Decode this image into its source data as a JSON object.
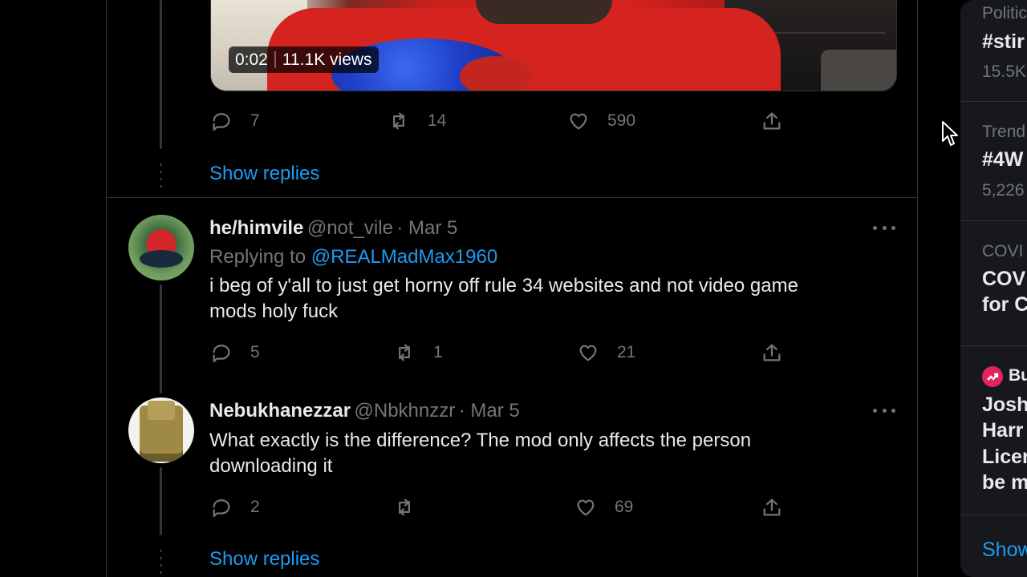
{
  "video": {
    "time": "0:02",
    "views": "11.1K views"
  },
  "tweets": [
    {
      "actions": {
        "replies": "7",
        "retweets": "14",
        "likes": "590"
      },
      "show_replies": "Show replies"
    },
    {
      "display_name": "he/himvile",
      "handle": "@not_vile",
      "date": "· Mar 5",
      "replying_to_label": "Replying to",
      "replying_to_handle": "@REALMadMax1960",
      "text_line1": "i beg of y'all to just get horny off rule 34 websites and not video game",
      "text_line2": "mods holy fuck",
      "actions": {
        "replies": "5",
        "retweets": "1",
        "likes": "21"
      }
    },
    {
      "display_name": "Nebukhanezzar",
      "handle": "@Nbkhnzzr",
      "date": "· Mar 5",
      "text_line1": "What exactly is the difference? The mod only affects the person",
      "text_line2": "downloading it",
      "actions": {
        "replies": "2",
        "retweets": "",
        "likes": "69"
      },
      "show_replies": "Show replies"
    }
  ],
  "sidebar": {
    "items": [
      {
        "category": "Politic",
        "title": "#stir",
        "count": "15.5K"
      },
      {
        "category": "Trend",
        "title": "#4W",
        "count": "5,226"
      },
      {
        "category": "COVI",
        "title_line1": "COV",
        "title_line2": "for C"
      },
      {
        "category": "Bu",
        "title_line1": "Josh",
        "title_line2": "Harr",
        "title_line3": "Licer",
        "title_line4": "be m"
      }
    ],
    "show_more": "Show"
  },
  "colors": {
    "accent": "#1d9bf0",
    "background": "#000000",
    "secondary_text": "#71767b",
    "sidebar_bg": "#16181c"
  }
}
